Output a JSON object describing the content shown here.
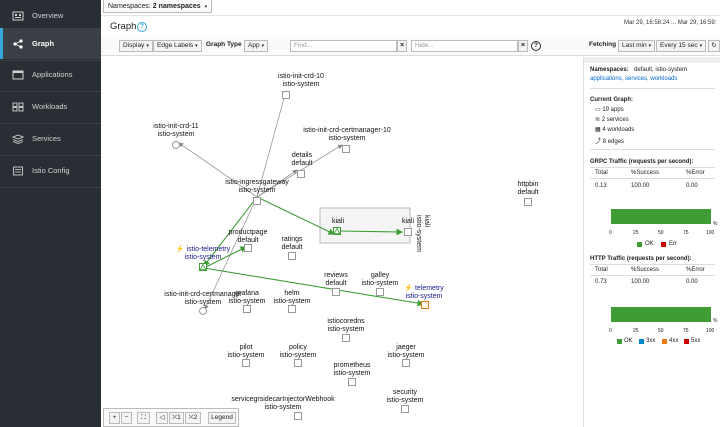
{
  "sidebar": {
    "items": [
      {
        "label": "Overview",
        "icon": "overview-icon"
      },
      {
        "label": "Graph",
        "icon": "graph-icon",
        "active": true
      },
      {
        "label": "Applications",
        "icon": "applications-icon"
      },
      {
        "label": "Workloads",
        "icon": "workloads-icon"
      },
      {
        "label": "Services",
        "icon": "services-icon"
      },
      {
        "label": "Istio Config",
        "icon": "istio-config-icon"
      }
    ]
  },
  "topbar": {
    "namespaces_prefix": "Namespaces:",
    "namespaces_value": "2 namespaces"
  },
  "header": {
    "title": "Graph",
    "help": "?",
    "time_range": "Mar 29, 16:58:24 ... Mar 29, 16:59:"
  },
  "toolbar": {
    "display": "Display",
    "edge_labels": "Edge Labels",
    "graph_type_label": "Graph Type",
    "graph_type_value": "App",
    "find_placeholder": "Find...",
    "hide_placeholder": "Hide...",
    "clear": "×",
    "help": "?",
    "fetching_label": "Fetching",
    "fetch_range": "Last min",
    "refresh_interval": "Every 15 sec"
  },
  "graph": {
    "nodes": [
      {
        "id": "istio-init-crd-10",
        "lines": [
          "istio-init-crd-10",
          "istio-system"
        ]
      },
      {
        "id": "istio-init-crd-11",
        "lines": [
          "istio-init-crd-11",
          "istio-system"
        ]
      },
      {
        "id": "istio-init-crd-certmanager-10",
        "lines": [
          "istio-init-crd-certmanager-10",
          "istio-system"
        ]
      },
      {
        "id": "details",
        "lines": [
          "details",
          "default"
        ]
      },
      {
        "id": "istio-ingressgateway",
        "lines": [
          "istio-ingressgateway",
          "istio-system"
        ]
      },
      {
        "id": "kiali-app",
        "lines": [
          "kiali"
        ]
      },
      {
        "id": "kiali-svc",
        "lines": [
          "kiali"
        ]
      },
      {
        "id": "kiali-box",
        "lines": [
          "kiali",
          "istio-system"
        ]
      },
      {
        "id": "httpbin",
        "lines": [
          "httpbin",
          "default"
        ]
      },
      {
        "id": "productpage",
        "lines": [
          "productpage",
          "default"
        ]
      },
      {
        "id": "ratings",
        "lines": [
          "ratings",
          "default"
        ]
      },
      {
        "id": "istio-telemetry",
        "lines": [
          "istio-telemetry",
          "istio-system"
        ]
      },
      {
        "id": "reviews",
        "lines": [
          "reviews",
          "default"
        ]
      },
      {
        "id": "galley",
        "lines": [
          "galley",
          "istio-system"
        ]
      },
      {
        "id": "telemetry",
        "lines": [
          "telemetry",
          "istio-system"
        ]
      },
      {
        "id": "istio-init-crd-certmanager",
        "lines": [
          "istio-init-crd-certmanager",
          "istio-system"
        ]
      },
      {
        "id": "grafana",
        "lines": [
          "grafana",
          "istio-system"
        ]
      },
      {
        "id": "helm",
        "lines": [
          "helm",
          "istio-system"
        ]
      },
      {
        "id": "istiocoredns",
        "lines": [
          "istiocoredns",
          "istio-system"
        ]
      },
      {
        "id": "pilot",
        "lines": [
          "pilot",
          "istio-system"
        ]
      },
      {
        "id": "policy",
        "lines": [
          "policy",
          "istio-system"
        ]
      },
      {
        "id": "jaeger",
        "lines": [
          "jaeger",
          "istio-system"
        ]
      },
      {
        "id": "prometheus",
        "lines": [
          "prometheus",
          "istio-system"
        ]
      },
      {
        "id": "sidecar-injector",
        "lines": [
          "servicegrsidecarInjectorWebhook",
          "istio-system"
        ]
      },
      {
        "id": "security",
        "lines": [
          "security",
          "istio-system"
        ]
      }
    ]
  },
  "graph_controls": {
    "zoom_in": "+",
    "zoom_out": "−",
    "fit": "⛶",
    "layout0": "◁",
    "layout1": "⛌1",
    "layout2": "⛌2",
    "legend": "Legend"
  },
  "side_panel": {
    "namespaces_label": "Namespaces:",
    "namespaces_value": "default, istio-system",
    "links": "applications, services, workloads",
    "current_graph_label": "Current Graph:",
    "apps": "19 apps",
    "services": "2 services",
    "workloads": "4 workloads",
    "edges": "8 edges",
    "grpc_title": "GRPC Traffic (requests per second):",
    "http_title": "HTTP Traffic (requests per second):",
    "col_total": "Total",
    "col_success": "%Success",
    "col_error": "%Error",
    "grpc_total": "0.13",
    "grpc_success": "100.00",
    "grpc_error": "0.00",
    "http_total": "0.73",
    "http_success": "100.00",
    "http_error": "0.00",
    "axis_ticks": [
      "0",
      "25",
      "50",
      "75",
      "100"
    ],
    "pct": "%",
    "grpc_legend": [
      "OK",
      "Err"
    ],
    "http_legend": [
      "OK",
      "3xx",
      "4xx",
      "5xx"
    ],
    "colors": {
      "ok": "#3f9c35",
      "err": "#cc0000",
      "3xx": "#0088ce",
      "4xx": "#ec7a08",
      "5xx": "#cc0000"
    },
    "grpc_ok_fraction": 1.0,
    "http_ok_fraction": 1.0
  }
}
